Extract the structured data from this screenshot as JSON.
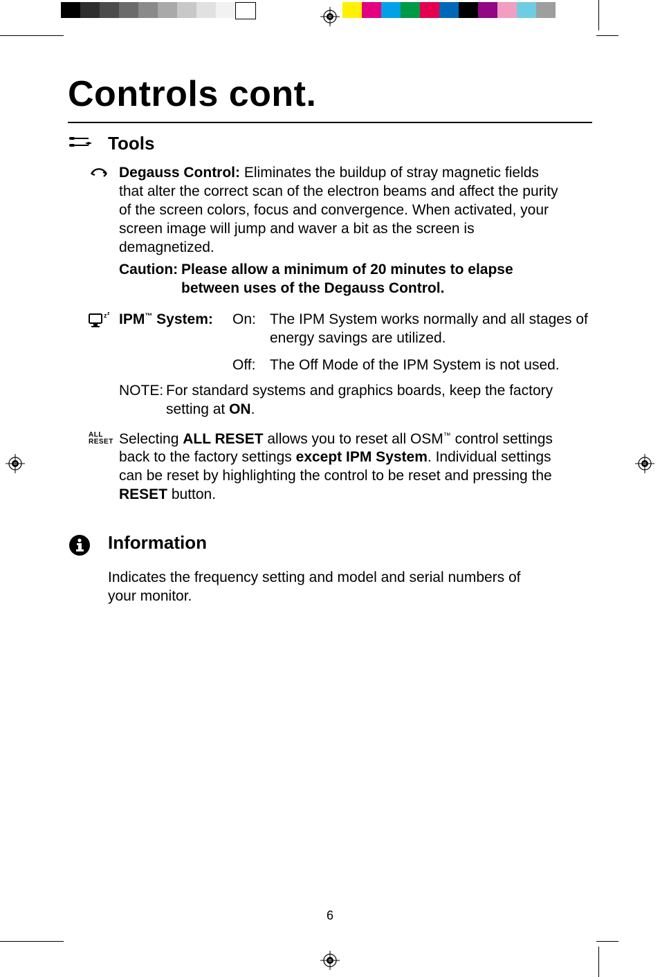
{
  "page_title": "Controls cont.",
  "page_number": "6",
  "tools": {
    "heading": "Tools",
    "degauss": {
      "label": "Degauss Control:",
      "body": "Eliminates the buildup of stray magnetic fields that alter the correct scan of the electron beams and affect the purity of the screen colors, focus and convergence.  When activated, your screen image will jump and waver a bit as the screen is demagnetized.",
      "caution_label": "Caution:",
      "caution_text": "Please allow a minimum of 20 minutes to elapse between uses of the Degauss Control."
    },
    "ipm": {
      "label_prefix": "IPM",
      "label_suffix": " System:",
      "on_label": "On:",
      "on_text": "The IPM System works normally and all stages of energy savings are utilized.",
      "off_label": "Off:",
      "off_text": "The Off Mode of the IPM System is not used.",
      "note_label": "NOTE:",
      "note_text_1": "For standard systems and graphics boards, keep the factory setting at ",
      "note_on": "ON",
      "note_text_2": "."
    },
    "all_reset": {
      "text_1": "Selecting ",
      "bold_1": "ALL RESET",
      "text_2": " allows you to reset all OSM",
      "text_3": " control settings back to the factory settings ",
      "bold_2": "except IPM System",
      "text_4": ". Individual settings can be reset by highlighting the control to be reset and pressing the ",
      "bold_3": "RESET",
      "text_5": " button."
    }
  },
  "information": {
    "heading": "Information",
    "body": "Indicates the frequency setting and model and serial numbers of your monitor."
  },
  "trademark": "™",
  "grayscale_swatches": [
    "#000000",
    "#2e2e2e",
    "#4c4c4c",
    "#6b6b6b",
    "#8a8a8a",
    "#a9a9a9",
    "#c8c8c8",
    "#e1e1e1",
    "#f2f2f2",
    "#ffffff"
  ],
  "color_swatches": [
    "#fff100",
    "#e4007f",
    "#00a1e9",
    "#009944",
    "#e5004f",
    "#0068b7",
    "#000000",
    "#920783",
    "#f19ec2",
    "#6fcde3",
    "#9e9e9e"
  ]
}
